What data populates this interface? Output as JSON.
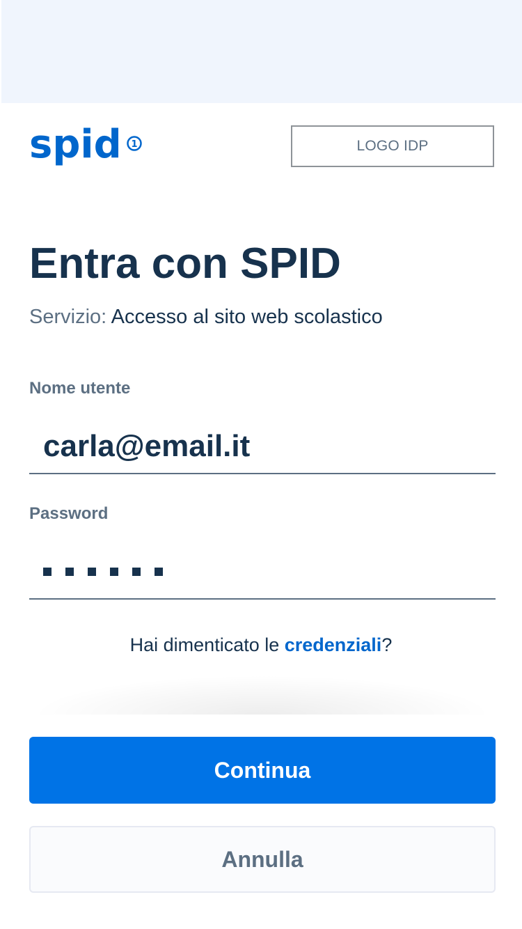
{
  "header": {
    "logo_text": "spid",
    "logo_badge": "1",
    "idp_logo_label": "LOGO IDP"
  },
  "main": {
    "title": "Entra con SPID",
    "service_label": "Servizio:",
    "service_value": "Accesso al sito web scolastico"
  },
  "form": {
    "username_label": "Nome utente",
    "username_value": "carla@email.it",
    "password_label": "Password",
    "password_mask_count": 6,
    "forgot_prefix": "Hai dimenticato le ",
    "forgot_link": "credenziali",
    "forgot_suffix": "?"
  },
  "actions": {
    "continue_label": "Continua",
    "cancel_label": "Annulla"
  },
  "colors": {
    "brand_blue": "#0066cc",
    "primary_button": "#0073e6",
    "text_dark": "#17324d",
    "text_muted": "#5c6f82",
    "top_band": "#f0f5fd"
  }
}
